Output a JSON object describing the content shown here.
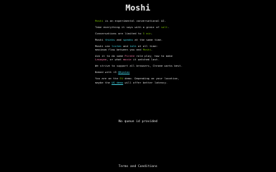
{
  "page": {
    "title": "Moshi"
  },
  "intro": {
    "l1": {
      "a": "Moshi",
      "b": " is an experimental conversational AI."
    },
    "l2": {
      "a": "Take everything it says with a grain of ",
      "b": "salt",
      "c": "."
    },
    "l3": {
      "a": "Conversations are limited to ",
      "b": "5 min",
      "c": "."
    },
    "l4": {
      "a": "Moshi ",
      "b": "thinks",
      "c": " and ",
      "d": "speaks",
      "e": " at the same time."
    },
    "l5": {
      "a": "Moshi can ",
      "b": "listen",
      "c": " and ",
      "d": "talk",
      "e": " at all time:"
    },
    "l6": {
      "a": "maximum flow between you and ",
      "b": "Moshi",
      "c": "."
    },
    "l7": {
      "a": "Ask it to do some ",
      "b": "Pirate",
      "c": " role play, how to make"
    },
    "l8": {
      "a": "Lasagna",
      "b": ", or what ",
      "c": "movie",
      "d": " it watched last."
    },
    "l9": {
      "a": "We strive to support all browsers, Chrome works best."
    },
    "l10": {
      "a": "Baked with <3 ",
      "b": "@Kyutai"
    },
    "l11": {
      "a": "You are on the ",
      "b": "EU",
      "c": " demo. Depending on your location,"
    },
    "l12": {
      "a": "maybe the ",
      "b": "US demo",
      "c": " will offer better latency."
    }
  },
  "status": {
    "queue_message": "No queue id provided"
  },
  "footer": {
    "terms_label": "Terms and Conditions"
  },
  "colors": {
    "background": "#000000",
    "text": "#e8e8e8",
    "accent_green": "#76b900",
    "accent_cyan": "#3fd0e0",
    "accent_pink": "#f07aa7"
  }
}
